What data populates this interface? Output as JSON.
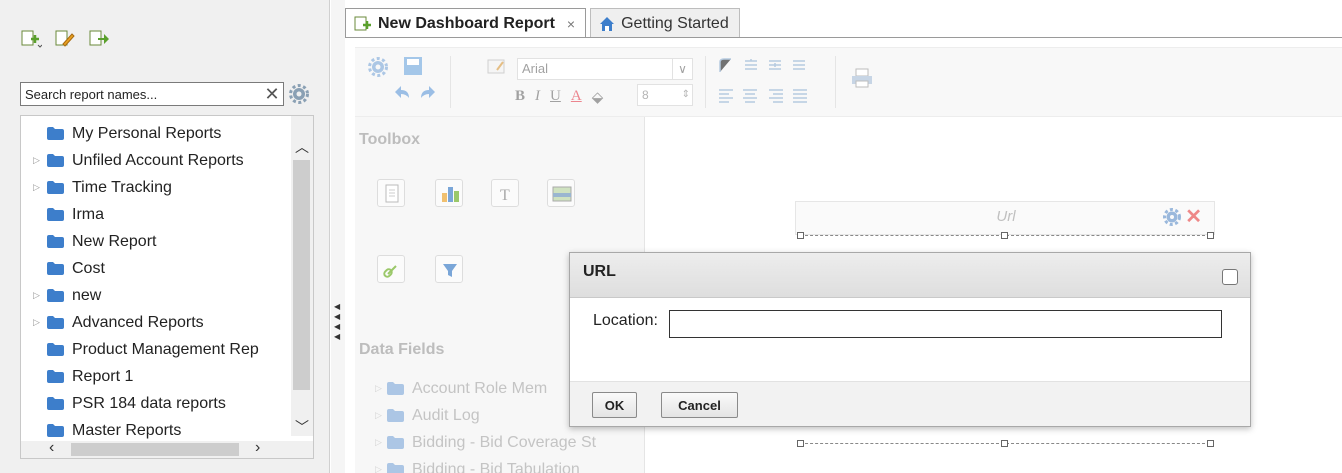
{
  "left_panel": {
    "toolbar_icons": [
      "new-report-icon",
      "edit-report-icon",
      "export-report-icon"
    ],
    "search": {
      "placeholder": "Search report names...",
      "value": "",
      "clear_label": "✕"
    },
    "tree": [
      {
        "label": "My Personal Reports",
        "expandable": false
      },
      {
        "label": "Unfiled Account Reports",
        "expandable": true
      },
      {
        "label": "Time Tracking",
        "expandable": true
      },
      {
        "label": "Irma",
        "expandable": false
      },
      {
        "label": "New Report",
        "expandable": false
      },
      {
        "label": "Cost",
        "expandable": false
      },
      {
        "label": "new",
        "expandable": true
      },
      {
        "label": "Advanced Reports",
        "expandable": true
      },
      {
        "label": "Product Management Rep",
        "expandable": false
      },
      {
        "label": "Report 1",
        "expandable": false
      },
      {
        "label": "PSR 184 data reports",
        "expandable": false
      },
      {
        "label": "Master Reports",
        "expandable": false
      }
    ]
  },
  "tabs": [
    {
      "label": "New Dashboard Report",
      "active": true,
      "close": "×"
    },
    {
      "label": "Getting Started",
      "active": false
    }
  ],
  "toolbar": {
    "font_name": "Arial",
    "font_size": "8",
    "format_buttons": [
      "B",
      "I",
      "U",
      "A"
    ]
  },
  "toolbox": {
    "title": "Toolbox",
    "data_fields_title": "Data Fields",
    "data_fields": [
      "Account Role Mem",
      "Audit Log",
      "Bidding - Bid Coverage St",
      "Bidding - Bid Tabulation"
    ]
  },
  "canvas": {
    "widget_label": "Url"
  },
  "dialog": {
    "title": "URL",
    "location_label": "Location:",
    "location_value": "",
    "ok_label": "OK",
    "cancel_label": "Cancel"
  },
  "colors": {
    "folder_blue": "#3d7ecb",
    "accent": "#2a6ebb"
  }
}
